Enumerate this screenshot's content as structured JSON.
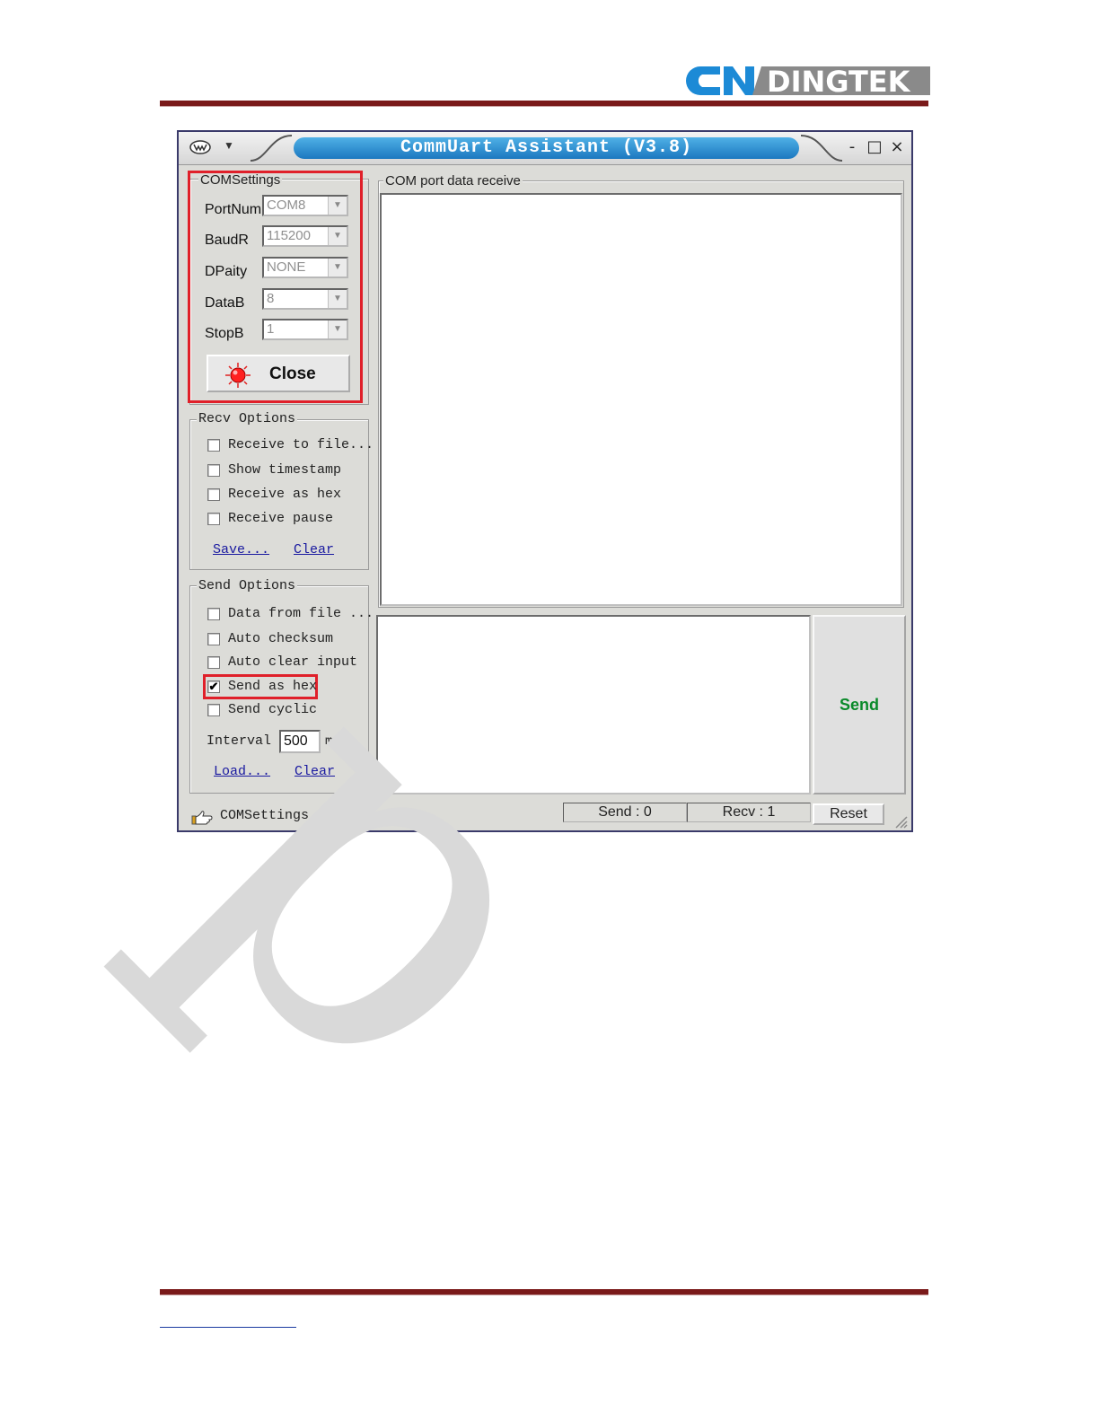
{
  "brand": {
    "logo_mark": "CN",
    "logo_text": "DINGTEK",
    "colors": {
      "logo_blue": "#1c8ad6",
      "logo_gray": "#8a8a8a",
      "rule": "#7a1a1a",
      "highlight": "#e0202a"
    }
  },
  "watermark": {
    "text": "p"
  },
  "window": {
    "title": "CommUart Assistant (V3.8)",
    "controls": {
      "minimize": "-",
      "maximize": "□",
      "close": "×"
    }
  },
  "com_settings": {
    "group_label": "COMSettings",
    "fields": [
      {
        "label": "PortNum",
        "value": "COM8"
      },
      {
        "label": "BaudR",
        "value": "115200"
      },
      {
        "label": "DPaity",
        "value": "NONE"
      },
      {
        "label": "DataB",
        "value": "8"
      },
      {
        "label": "StopB",
        "value": "1"
      }
    ],
    "close_button": "Close"
  },
  "recv_options": {
    "group_label": "Recv Options",
    "items": [
      {
        "label": "Receive to file...",
        "checked": false
      },
      {
        "label": "Show timestamp",
        "checked": false
      },
      {
        "label": "Receive as hex",
        "checked": false
      },
      {
        "label": "Receive pause",
        "checked": false
      }
    ],
    "save_link": "Save...",
    "clear_link": "Clear"
  },
  "send_options": {
    "group_label": "Send Options",
    "items": [
      {
        "label": "Data from file ...",
        "checked": false
      },
      {
        "label": "Auto checksum",
        "checked": false
      },
      {
        "label": "Auto clear input",
        "checked": false
      },
      {
        "label": "Send as hex",
        "checked": true
      },
      {
        "label": "Send cyclic",
        "checked": false
      }
    ],
    "interval_label": "Interval",
    "interval_value": "500",
    "interval_unit": "ms",
    "load_link": "Load...",
    "clear_link": "Clear"
  },
  "receive_panel": {
    "group_label": "COM port data receive"
  },
  "send_button": "Send",
  "status_bar": {
    "label": "COMSettings",
    "send_count": "Send : 0",
    "recv_count": "Recv : 1",
    "reset_button": "Reset"
  }
}
